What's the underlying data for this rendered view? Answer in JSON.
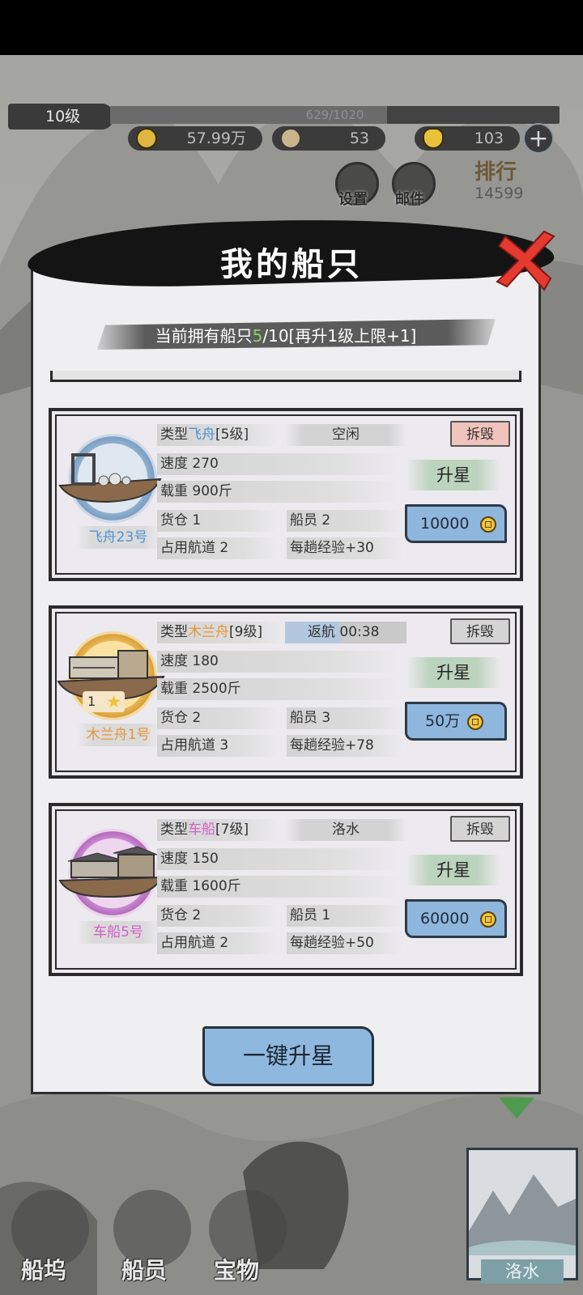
{
  "hud": {
    "level": "10级",
    "exp_text": "629/1020",
    "exp_progress": 0.617,
    "coins": "57.99万",
    "shells": "53",
    "gold": "103",
    "plus": "+"
  },
  "menu": {
    "settings_label": "设置",
    "mail_label": "邮件",
    "rank_title": "排行",
    "rank_value": "14599"
  },
  "modal": {
    "title": "我的船只",
    "count_prefix": "当前拥有船只",
    "count_current": "5",
    "count_suffix": "/10[再升1级上限+1]"
  },
  "ships": [
    {
      "name": "飞舟23号",
      "type_prefix": "类型",
      "type_name": "飞舟",
      "type_level": "[5级]",
      "status": "空闲",
      "speed": "速度 270",
      "load": "载重 900斤",
      "cargo": "货仓 1",
      "crew": "船员 2",
      "lanes": "占用航道 2",
      "exp": "每趟经验+30",
      "demolish": "拆毁",
      "upstar": "升星",
      "price": "10000",
      "theme_color": "#4f93d4"
    },
    {
      "name": "木兰舟1号",
      "type_prefix": "类型",
      "type_name": "木兰舟",
      "type_level": "[9级]",
      "status": "返航 00:38",
      "stars": "1",
      "speed": "速度 180",
      "load": "载重 2500斤",
      "cargo": "货仓 2",
      "crew": "船员 3",
      "lanes": "占用航道 3",
      "exp": "每趟经验+78",
      "demolish": "拆毁",
      "upstar": "升星",
      "price": "50万",
      "theme_color": "#e8963a"
    },
    {
      "name": "车船5号",
      "type_prefix": "类型",
      "type_name": "车船",
      "type_level": "[7级]",
      "status": "洛水",
      "speed": "速度 150",
      "load": "载重 1600斤",
      "cargo": "货仓 2",
      "crew": "船员 1",
      "lanes": "占用航道 2",
      "exp": "每趟经验+50",
      "demolish": "拆毁",
      "upstar": "升星",
      "price": "60000",
      "theme_color": "#d35ec8"
    }
  ],
  "one_key_upstar": "一键升星",
  "bottom_nav": {
    "dock": "船坞",
    "crew": "船员",
    "treasure": "宝物",
    "map_location": "洛水"
  }
}
